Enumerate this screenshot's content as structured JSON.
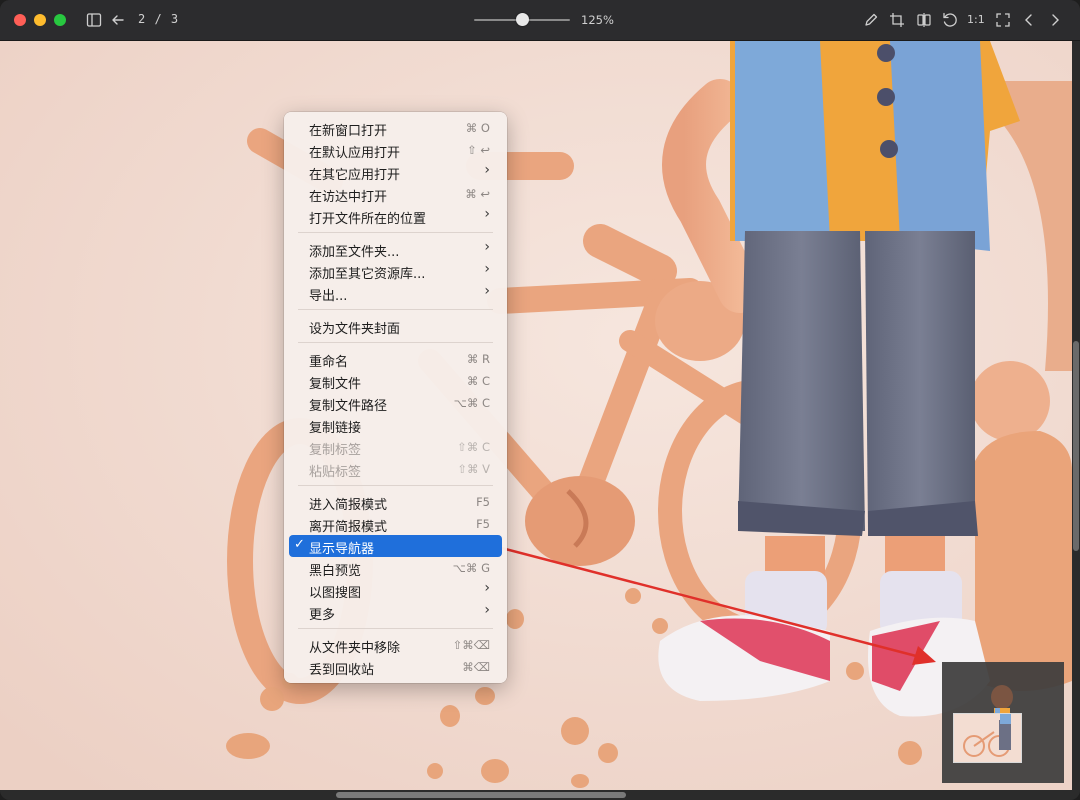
{
  "toolbar": {
    "page_counter": "2 / 3",
    "zoom_label": "125%",
    "zoom_level": 0.5
  },
  "context_menu": {
    "groups": [
      [
        {
          "label": "在新窗口打开",
          "shortcut": "⌘ O"
        },
        {
          "label": "在默认应用打开",
          "shortcut": "⇧ ↩"
        },
        {
          "label": "在其它应用打开",
          "submenu": true
        },
        {
          "label": "在访达中打开",
          "shortcut": "⌘ ↩"
        },
        {
          "label": "打开文件所在的位置",
          "submenu": true
        }
      ],
      [
        {
          "label": "添加至文件夹...",
          "submenu": true
        },
        {
          "label": "添加至其它资源库...",
          "submenu": true
        },
        {
          "label": "导出...",
          "submenu": true
        }
      ],
      [
        {
          "label": "设为文件夹封面"
        }
      ],
      [
        {
          "label": "重命名",
          "shortcut": "⌘ R"
        },
        {
          "label": "复制文件",
          "shortcut": "⌘ C"
        },
        {
          "label": "复制文件路径",
          "shortcut": "⌥⌘ C"
        },
        {
          "label": "复制链接"
        },
        {
          "label": "复制标签",
          "shortcut": "⇧⌘ C",
          "disabled": true
        },
        {
          "label": "粘贴标签",
          "shortcut": "⇧⌘ V",
          "disabled": true
        }
      ],
      [
        {
          "label": "进入简报模式",
          "shortcut": "F5"
        },
        {
          "label": "离开简报模式",
          "shortcut": "F5"
        },
        {
          "label": "显示导航器",
          "checked": true,
          "highlighted": true
        },
        {
          "label": "黑白预览",
          "shortcut": "⌥⌘ G"
        },
        {
          "label": "以图搜图",
          "submenu": true
        },
        {
          "label": "更多",
          "submenu": true
        }
      ],
      [
        {
          "label": "从文件夹中移除",
          "shortcut": "⇧⌘⌫"
        },
        {
          "label": "丢到回收站",
          "shortcut": "⌘⌫"
        }
      ]
    ],
    "checkmark": "✓",
    "chevron": "›"
  },
  "icons": [
    "sidebar-toggle-icon",
    "back-arrow-icon",
    "pencil-icon",
    "crop-icon",
    "flip-icon",
    "rotate-icon",
    "actual-size-icon",
    "fullscreen-icon",
    "chevron-left-icon",
    "chevron-right-icon"
  ],
  "actual_size_label": "1:1",
  "colors": {
    "menu_highlight": "#1f6fdb",
    "annotation_arrow": "#e0302a",
    "close": "#ff5f57",
    "minimize": "#febc2e",
    "zoom": "#28c840"
  }
}
